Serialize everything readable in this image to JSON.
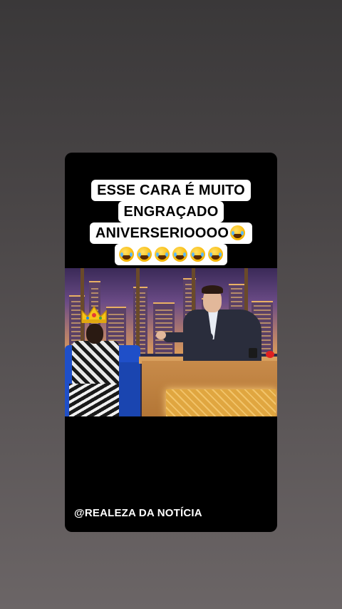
{
  "caption": {
    "lines": [
      "ESSE CARA É MUITO",
      "ENGRAÇADO",
      "ANIVERSERIOOOO"
    ],
    "emoji_name": "face-with-tears-of-joy-icon",
    "line3_emoji_count": 1,
    "line4_emoji_count": 6
  },
  "video": {
    "description_icons": [
      "crown-icon"
    ]
  },
  "watermark": "@REALEZA DA NOTÍCIA",
  "colors": {
    "background_top": "#3a3839",
    "background_bottom": "#6b6566",
    "card": "#000000",
    "caption_bg": "#ffffff",
    "caption_text": "#000000",
    "sofa": "#1f4fc8",
    "desk_glow": "#f2c46a"
  }
}
